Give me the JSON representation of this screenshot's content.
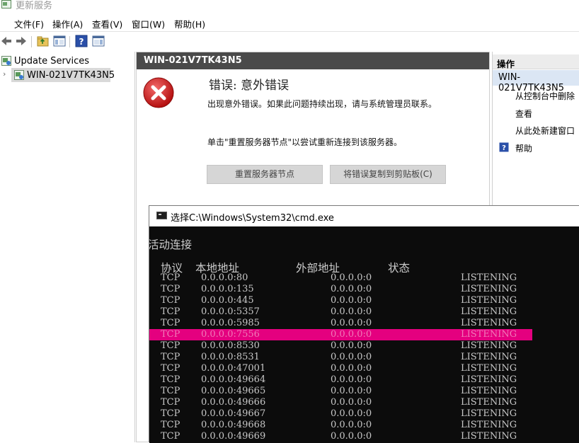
{
  "window": {
    "title": "更新服务"
  },
  "menu": [
    "文件(F)",
    "操作(A)",
    "查看(V)",
    "窗口(W)",
    "帮助(H)"
  ],
  "toolbar": {
    "icons": [
      "back-arrow-icon",
      "forward-arrow-icon",
      "up-folder-icon",
      "show-hide-tree-icon",
      "help-icon",
      "show-hide-action-pane-icon"
    ]
  },
  "tree": {
    "root": "Update Services",
    "server": "WIN-021V7TK43N5"
  },
  "center": {
    "header": "WIN-021V7TK43N5",
    "error_title": "错误: 意外错误",
    "error_message": "出现意外错误。如果此问题持续出现，请与系统管理员联系。",
    "error_hint": "单击\"重置服务器节点\"以尝试重新连接到该服务器。",
    "reset_button": "重置服务器节点",
    "copy_button": "将错误复制到剪贴板(C)"
  },
  "actions": {
    "header": "操作",
    "node": "WIN-021V7TK43N5",
    "items": [
      "从控制台中删除",
      "查看",
      "从此处新建窗口",
      "帮助"
    ]
  },
  "cmd": {
    "title": "选择C:\\Windows\\System32\\cmd.exe",
    "heading": "活动连接",
    "columns": [
      "协议",
      "本地地址",
      "外部地址",
      "状态"
    ],
    "rows": [
      {
        "proto": "TCP",
        "local": "0.0.0.0:80",
        "foreign": "0.0.0.0:0",
        "state": "LISTENING"
      },
      {
        "proto": "TCP",
        "local": "0.0.0.0:135",
        "foreign": "0.0.0.0:0",
        "state": "LISTENING"
      },
      {
        "proto": "TCP",
        "local": "0.0.0.0:445",
        "foreign": "0.0.0.0:0",
        "state": "LISTENING"
      },
      {
        "proto": "TCP",
        "local": "0.0.0.0:5357",
        "foreign": "0.0.0.0:0",
        "state": "LISTENING"
      },
      {
        "proto": "TCP",
        "local": "0.0.0.0:5985",
        "foreign": "0.0.0.0:0",
        "state": "LISTENING"
      },
      {
        "proto": "TCP",
        "local": "0.0.0.0:7556",
        "foreign": "0.0.0.0:0",
        "state": "LISTENING",
        "highlighted": true
      },
      {
        "proto": "TCP",
        "local": "0.0.0.0:8530",
        "foreign": "0.0.0.0:0",
        "state": "LISTENING"
      },
      {
        "proto": "TCP",
        "local": "0.0.0.0:8531",
        "foreign": "0.0.0.0:0",
        "state": "LISTENING"
      },
      {
        "proto": "TCP",
        "local": "0.0.0.0:47001",
        "foreign": "0.0.0.0:0",
        "state": "LISTENING"
      },
      {
        "proto": "TCP",
        "local": "0.0.0.0:49664",
        "foreign": "0.0.0.0:0",
        "state": "LISTENING"
      },
      {
        "proto": "TCP",
        "local": "0.0.0.0:49665",
        "foreign": "0.0.0.0:0",
        "state": "LISTENING"
      },
      {
        "proto": "TCP",
        "local": "0.0.0.0:49666",
        "foreign": "0.0.0.0:0",
        "state": "LISTENING"
      },
      {
        "proto": "TCP",
        "local": "0.0.0.0:49667",
        "foreign": "0.0.0.0:0",
        "state": "LISTENING"
      },
      {
        "proto": "TCP",
        "local": "0.0.0.0:49668",
        "foreign": "0.0.0.0:0",
        "state": "LISTENING"
      },
      {
        "proto": "TCP",
        "local": "0.0.0.0:49669",
        "foreign": "0.0.0.0:0",
        "state": "LISTENING"
      }
    ]
  },
  "colors": {
    "highlight": "#e4007f",
    "header_dark": "#4a4a4a",
    "console_bg": "#0c0c0c"
  }
}
